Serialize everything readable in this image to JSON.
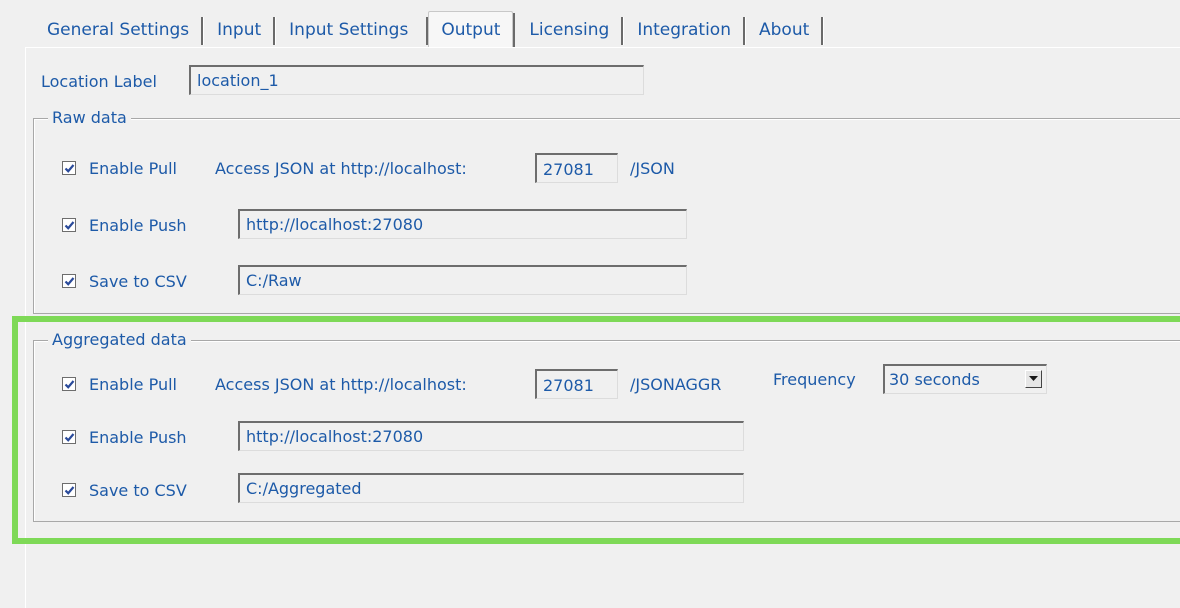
{
  "tabs": [
    {
      "label": "General Settings"
    },
    {
      "label": "Input"
    },
    {
      "label": "Input Settings"
    },
    {
      "label": "Output"
    },
    {
      "label": "Licensing"
    },
    {
      "label": "Integration"
    },
    {
      "label": "About"
    }
  ],
  "location": {
    "label": "Location Label",
    "value": "location_1"
  },
  "raw": {
    "title": "Raw data",
    "pull": {
      "label": "Enable Pull",
      "prefix": "Access JSON at http://localhost:",
      "port": "27081",
      "suffix": "/JSON"
    },
    "push": {
      "label": "Enable Push",
      "url": "http://localhost:27080"
    },
    "csv": {
      "label": "Save to CSV",
      "path": "C:/Raw"
    }
  },
  "aggregated": {
    "title": "Aggregated data",
    "pull": {
      "label": "Enable Pull",
      "prefix": "Access JSON at http://localhost:",
      "port": "27081",
      "suffix": "/JSONAGGR"
    },
    "frequency": {
      "label": "Frequency",
      "value": "30 seconds"
    },
    "push": {
      "label": "Enable Push",
      "url": "http://localhost:27080"
    },
    "csv": {
      "label": "Save to CSV",
      "path": "C:/Aggregated"
    }
  },
  "colors": {
    "text": "#1d5aa8",
    "background": "#f0f0f0",
    "highlight": "#7ed957"
  },
  "icons": {
    "checkbox": "checkmark-icon",
    "dropdown": "dropdown-arrow-icon"
  }
}
